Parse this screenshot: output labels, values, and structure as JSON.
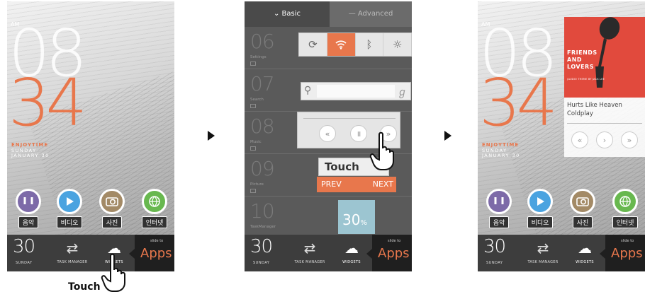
{
  "colors": {
    "accent": "#e8774c",
    "dock": "#3d3d3d",
    "album": "#e14a3d",
    "panel_gray": "#5a5a5a",
    "tm_widget": "#9cc5d1"
  },
  "home": {
    "am": "AM",
    "hour": "08",
    "minute": "34",
    "tagline": "ENJOYTIME",
    "weekday": "SUNDAY",
    "date": "JANUARY 30",
    "apps": [
      {
        "label": "음악",
        "icon": "earphones-icon",
        "color": "#7d6aa8"
      },
      {
        "label": "비디오",
        "icon": "play-icon",
        "color": "#4aa3e0"
      },
      {
        "label": "사진",
        "icon": "camera-icon",
        "color": "#a38a66"
      },
      {
        "label": "인터넷",
        "icon": "globe-icon",
        "color": "#68b84f"
      }
    ],
    "dock": {
      "date_num": "30",
      "weekday": "SUNDAY",
      "task_manager": "TASK MANAGER",
      "widgets": "WIDGETS",
      "slide_to": "slide to",
      "apps": "Apps"
    }
  },
  "caption_touch": "Touch",
  "widgets_screen": {
    "tabs": {
      "basic": "Basic",
      "advanced": "Advanced"
    },
    "rows": [
      {
        "num": "06",
        "label": "Settings"
      },
      {
        "num": "07",
        "label": "Search"
      },
      {
        "num": "08",
        "label": "Music"
      },
      {
        "num": "09",
        "label": "Picture"
      },
      {
        "num": "10",
        "label": "TaskManager"
      }
    ],
    "picture_touch": "Touch",
    "prev": "PREV",
    "next": "NEXT",
    "task_percent": "30",
    "task_unit": "%"
  },
  "music": {
    "album_title_line1": "FRIENDS",
    "album_title_line2": "AND",
    "album_title_line3": "LOVERS",
    "album_sub": "(AUDIO THEME BY JACK LEE",
    "song": "Hurts Like Heaven",
    "artist": "Coldplay"
  }
}
